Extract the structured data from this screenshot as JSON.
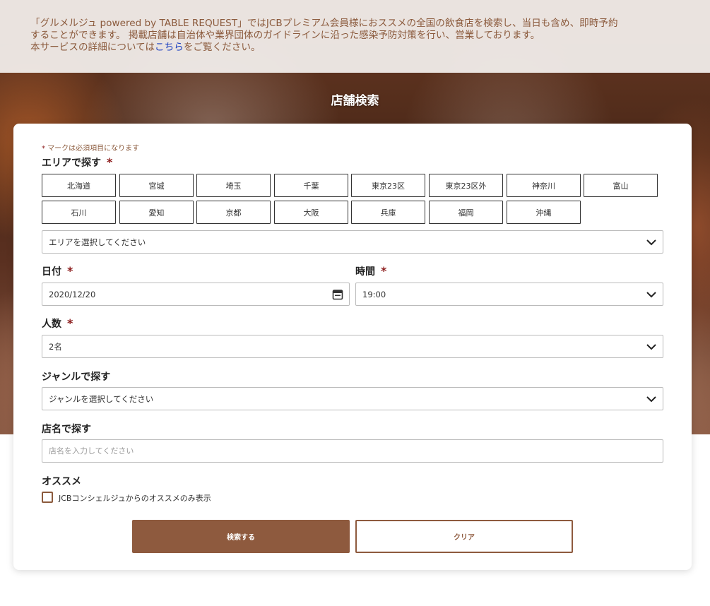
{
  "notice": {
    "line1": "「グルメルジュ powered by TABLE REQUEST」ではJCBプレミアム会員様におススメの全国の飲食店を検索し、当日も含め、即時予約",
    "line2": "することができます。 掲載店舗は自治体や業界団体のガイドラインに沿った感染予防対策を行い、営業しております。",
    "line3_pre": "本サービスの詳細については",
    "line3_link": "こちら",
    "line3_post": "をご覧ください。"
  },
  "hero": {
    "title": "店舗検索"
  },
  "form": {
    "required_mark": "*",
    "required_note": "マークは必須項目になります",
    "area": {
      "label": "エリアで探す",
      "buttons": [
        "北海道",
        "宮城",
        "埼玉",
        "千葉",
        "東京23区",
        "東京23区外",
        "神奈川",
        "富山",
        "石川",
        "愛知",
        "京都",
        "大阪",
        "兵庫",
        "福岡",
        "沖縄"
      ],
      "select_value": "エリアを選択してください"
    },
    "date": {
      "label": "日付",
      "value": "2020/12/20"
    },
    "time": {
      "label": "時間",
      "value": "19:00"
    },
    "people": {
      "label": "人数",
      "value": "2名"
    },
    "genre": {
      "label": "ジャンルで探す",
      "select_value": "ジャンルを選択してください"
    },
    "shop_name": {
      "label": "店名で探す",
      "placeholder": "店名を入力してください"
    },
    "recommend": {
      "label": "オススメ",
      "checkbox_label": "JCBコンシェルジュからのオススメのみ表示"
    },
    "search_button": "検索する",
    "clear_button": "クリア"
  },
  "colors": {
    "accent": "#8e5a3e",
    "required": "#8b1a1a",
    "link": "#1a3fc0"
  },
  "icons": {
    "select": "chevron-down-icon",
    "date": "calendar-icon"
  }
}
